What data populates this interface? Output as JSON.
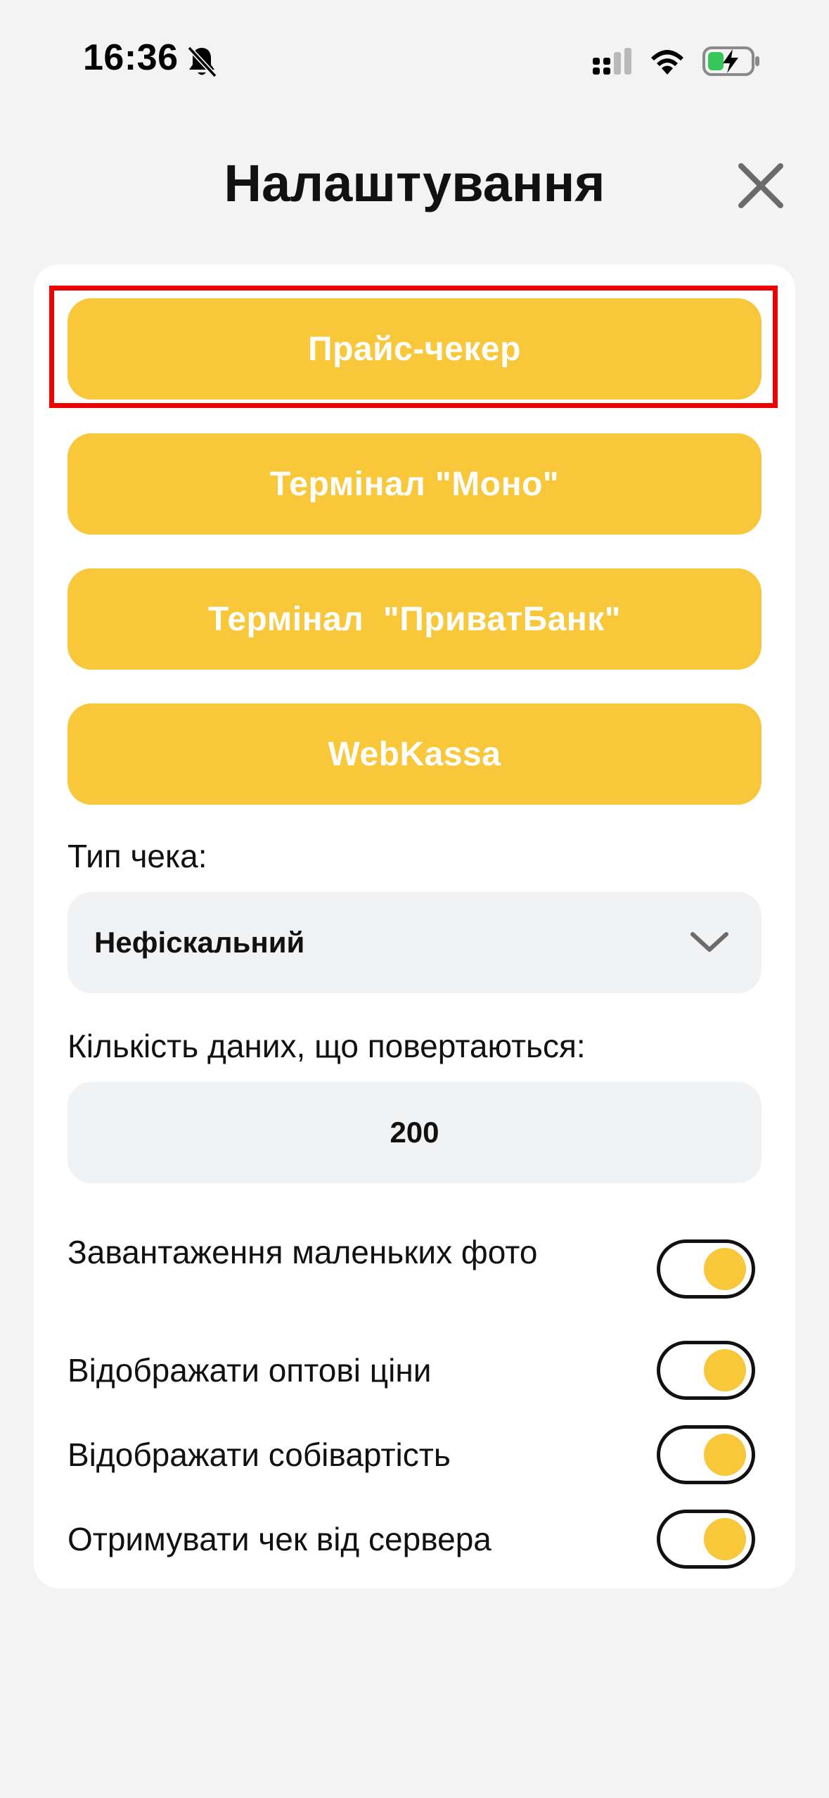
{
  "status_bar": {
    "time": "16:36"
  },
  "header": {
    "title": "Налаштування"
  },
  "buttons": {
    "price_checker": "Прайс-чекер",
    "terminal_mono": "Термінал \"Моно\"",
    "terminal_privat": "Термінал  \"ПриватБанк\"",
    "webkassa": "WebKassa"
  },
  "receipt_type": {
    "label": "Тип чека:",
    "value": "Нефіскальний"
  },
  "data_count": {
    "label": "Кількість даних, що повертаються:",
    "value": "200"
  },
  "toggles": [
    {
      "label": "Завантаження маленьких фото",
      "on": true
    },
    {
      "label": "Відображати оптові ціни",
      "on": true
    },
    {
      "label": "Відображати собівартість",
      "on": true
    },
    {
      "label": "Отримувати чек від сервера",
      "on": true
    }
  ],
  "colors": {
    "accent": "#f9c73a",
    "highlight": "#ee0000",
    "background": "#f3f3f4",
    "field": "#f1f2f4"
  }
}
